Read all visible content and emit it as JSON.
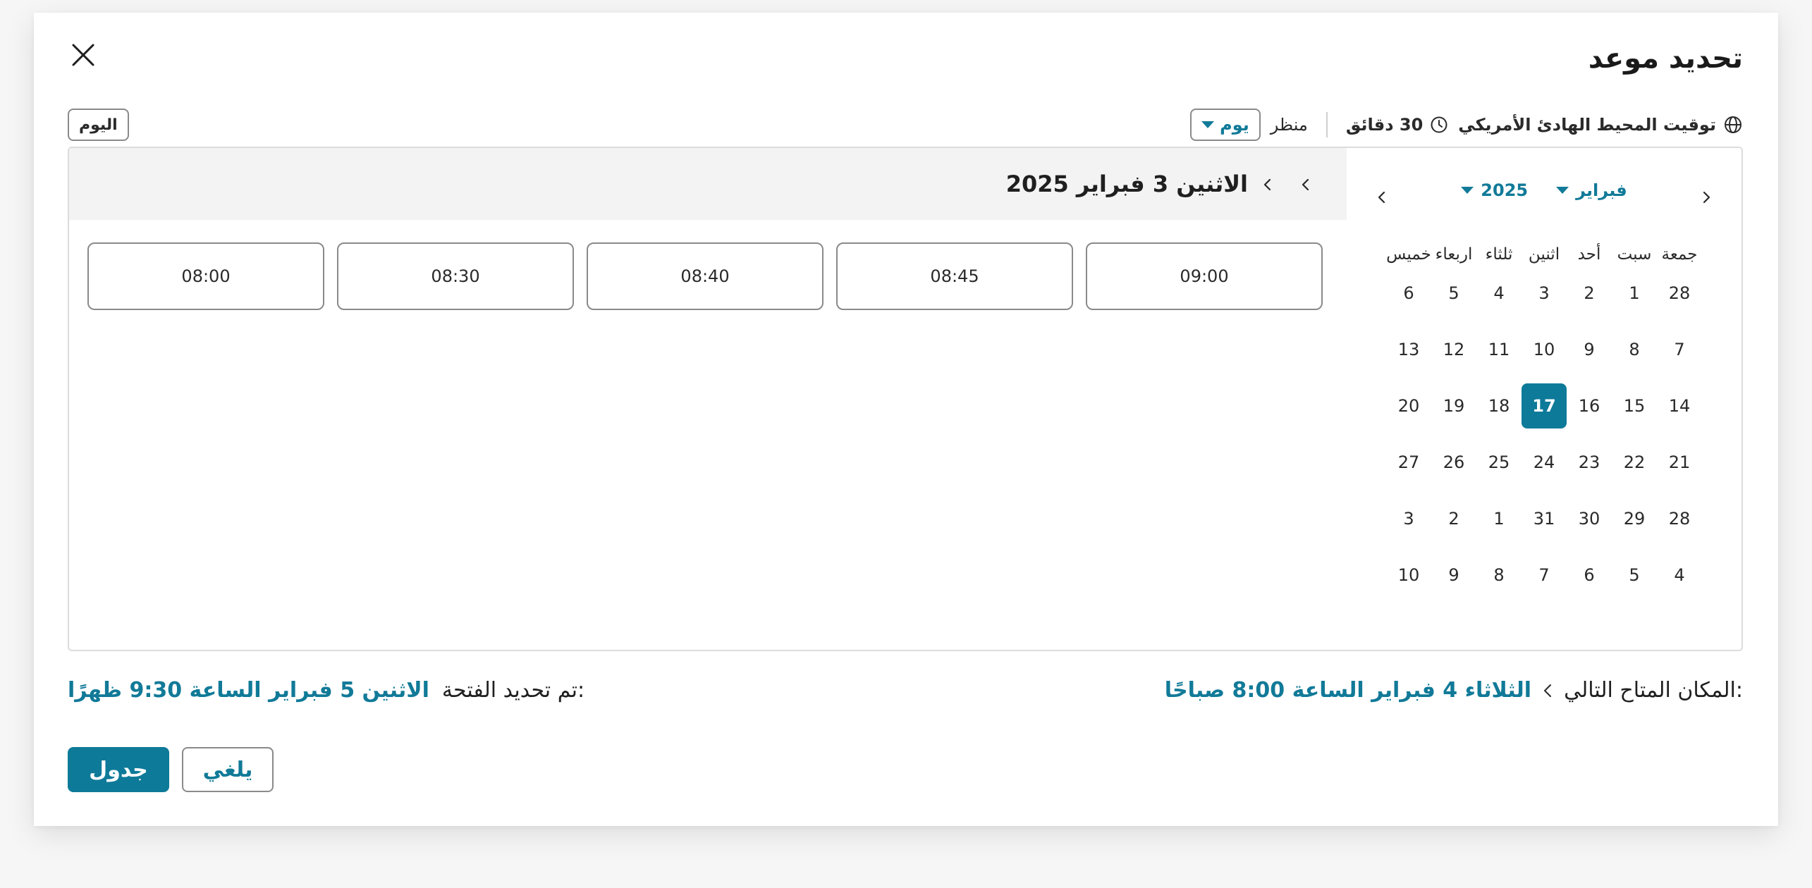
{
  "dialog": {
    "title": "تحديد موعد",
    "timezone": "توقيت المحيط الهادئ الأمريكي",
    "duration": "30 دقائق",
    "view_label": "منظر",
    "view_value": "يوم",
    "today_button": "اليوم"
  },
  "calendar": {
    "month": "فبراير",
    "year": "2025",
    "weekdays": [
      "جمعة",
      "سبت",
      "أحد",
      "اثنين",
      "ثلثاء",
      "اربعاء",
      "خميس"
    ],
    "weeks": [
      [
        "28",
        "1",
        "2",
        "3",
        "4",
        "5",
        "6"
      ],
      [
        "7",
        "8",
        "9",
        "10",
        "11",
        "12",
        "13"
      ],
      [
        "14",
        "15",
        "16",
        "17",
        "18",
        "19",
        "20"
      ],
      [
        "21",
        "22",
        "23",
        "24",
        "25",
        "26",
        "27"
      ],
      [
        "28",
        "29",
        "30",
        "31",
        "1",
        "2",
        "3"
      ],
      [
        "4",
        "5",
        "6",
        "7",
        "8",
        "9",
        "10"
      ]
    ],
    "selected_day": "17"
  },
  "slots": {
    "date_title": "الاثنين 3 فبراير 2025",
    "times": [
      "09:00",
      "08:45",
      "08:40",
      "08:30",
      "08:00"
    ]
  },
  "footer": {
    "next_available_label": ":المكان المتاح التالي",
    "next_available_value": "الثلاثاء 4 فبراير الساعة 8:00 صباحًا",
    "selected_label": ":تم تحديد الفتحة",
    "selected_value": "الاثنين 5 فبراير الساعة 9:30 ظهرًا",
    "schedule_button": "جدول",
    "cancel_button": "يلغي"
  },
  "colors": {
    "accent": "#0e7a99",
    "link": "#117a98"
  }
}
